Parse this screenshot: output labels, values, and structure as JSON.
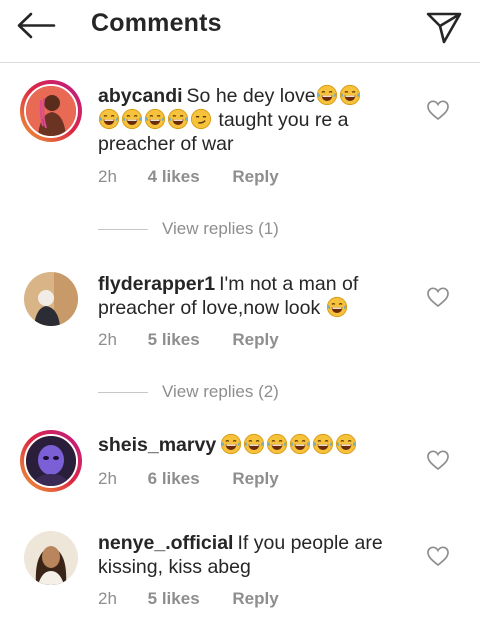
{
  "header": {
    "title": "Comments"
  },
  "comments": [
    {
      "username": "abycandi",
      "text_before": "So he dey love",
      "text_after": "taught you re a preacher of war",
      "time": "2h",
      "likes": "4 likes",
      "reply": "Reply",
      "view_replies": "View replies (1)"
    },
    {
      "username": "flyderapper1",
      "text_before": "I'm not a man of preacher of love,now look",
      "time": "2h",
      "likes": "5 likes",
      "reply": "Reply",
      "view_replies": "View replies (2)"
    },
    {
      "username": "sheis_marvy",
      "time": "2h",
      "likes": "6 likes",
      "reply": "Reply"
    },
    {
      "username": "nenye_.official",
      "text_before": "If you people are kissing, kiss abeg",
      "time": "2h",
      "likes": "5 likes",
      "reply": "Reply"
    }
  ]
}
